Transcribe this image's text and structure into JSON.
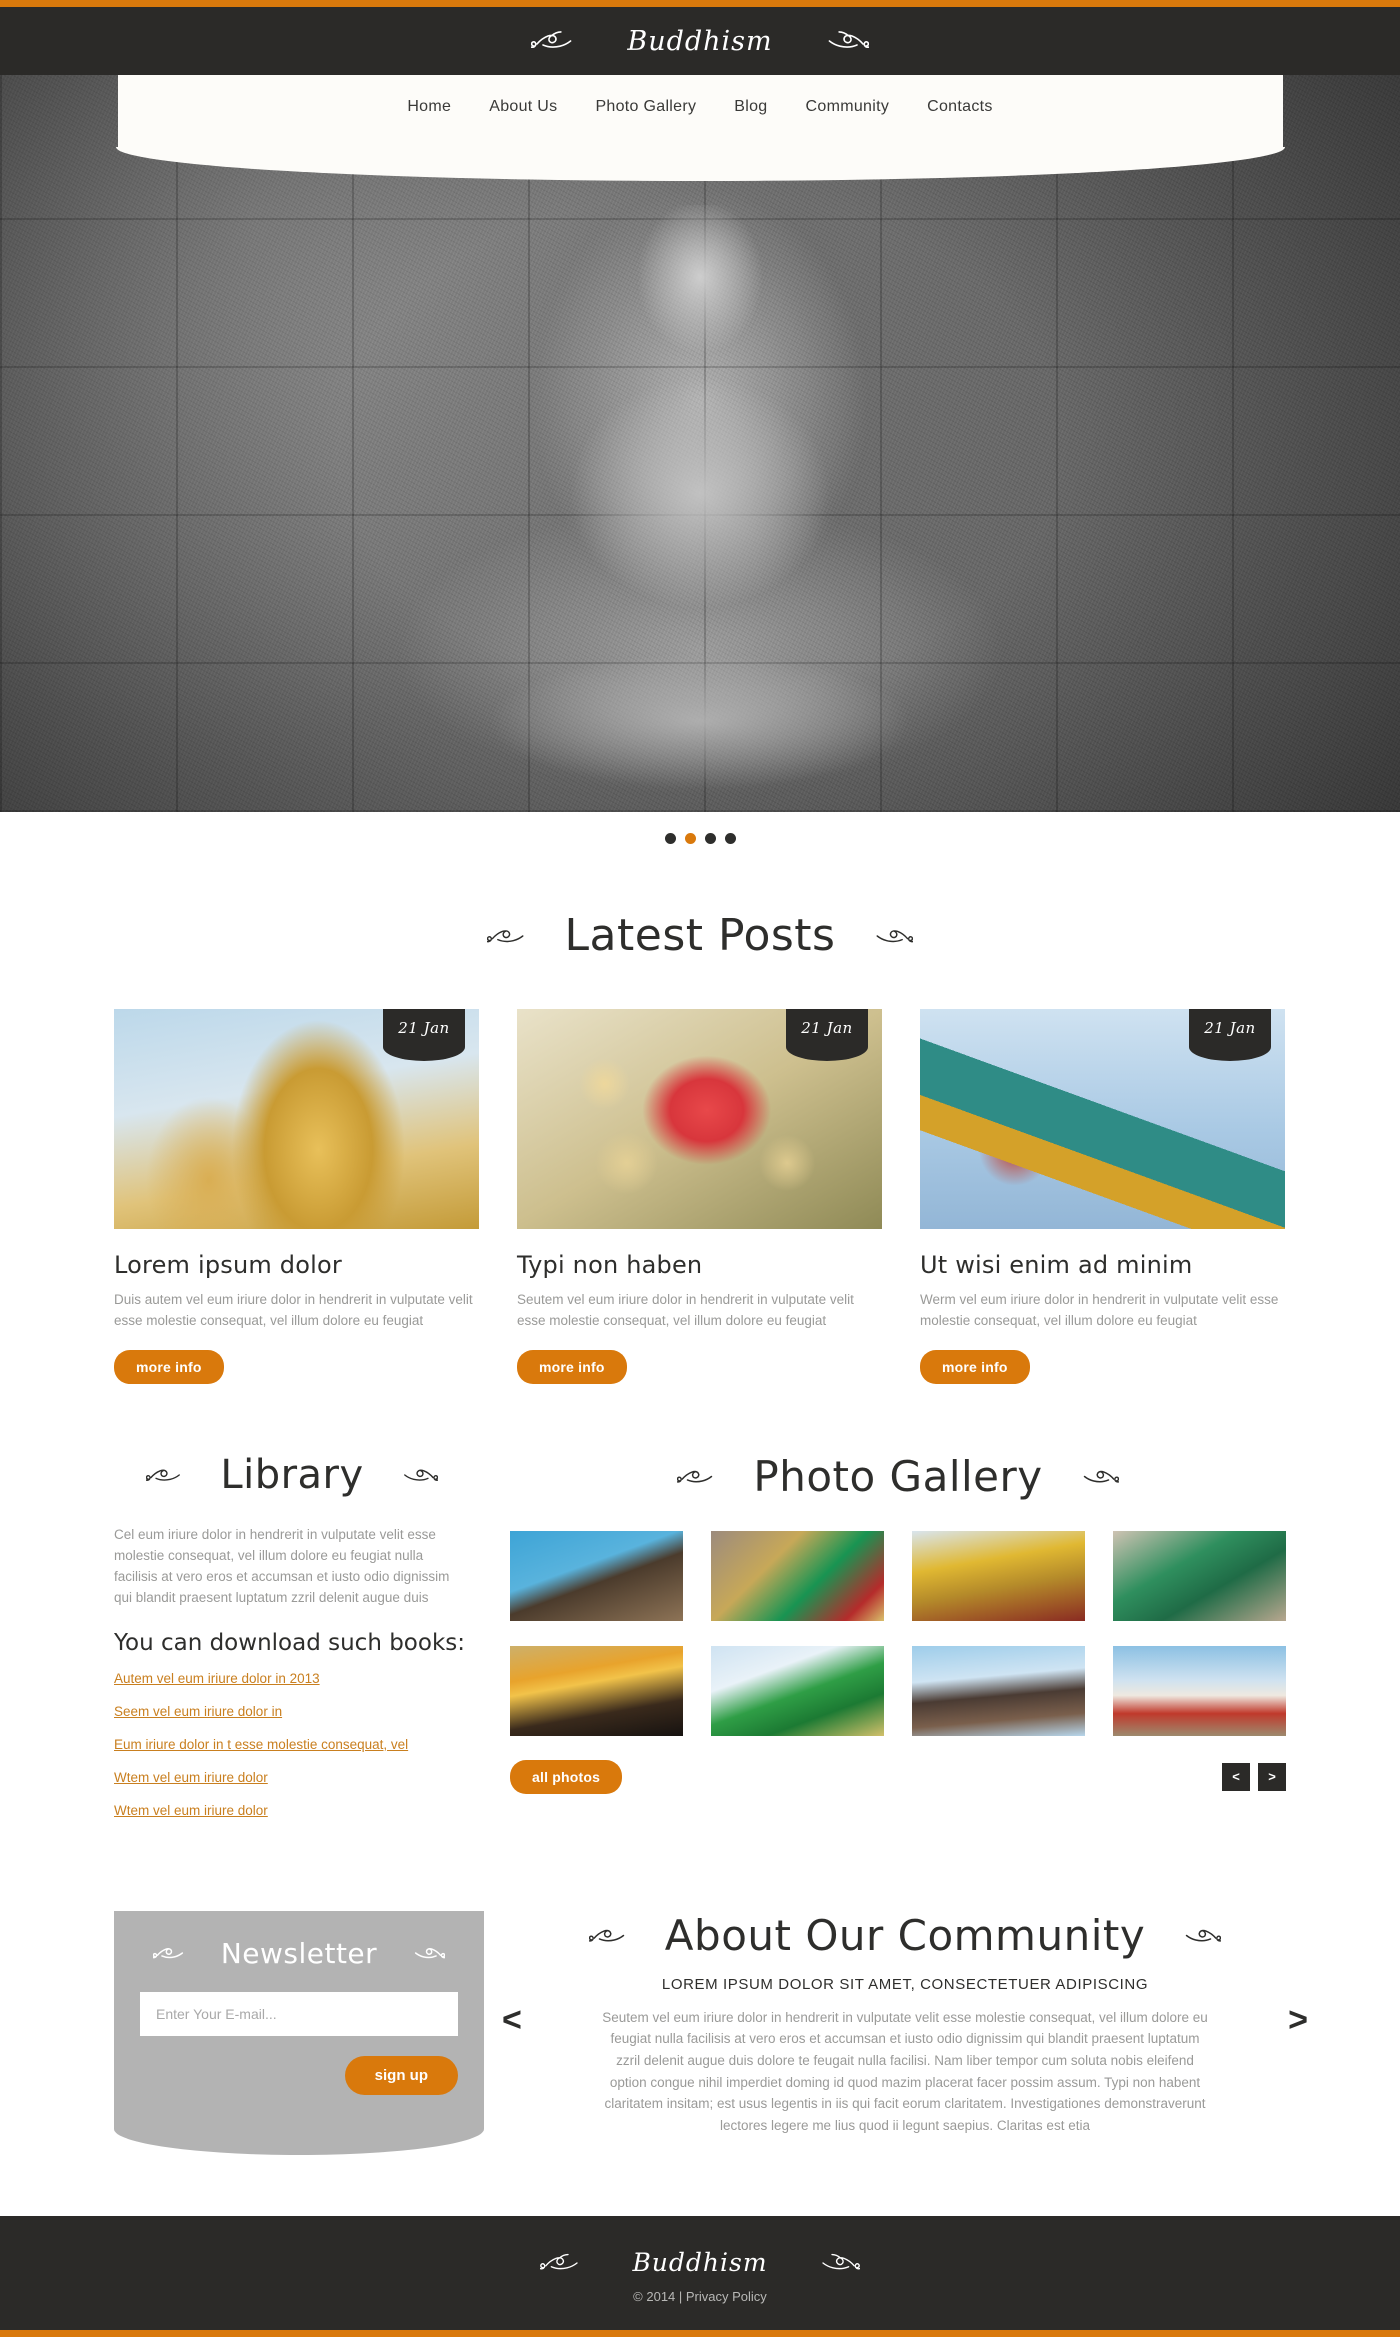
{
  "brand": {
    "name": "Buddhism",
    "left_flourish_icon": "flourish-left-icon",
    "right_flourish_icon": "flourish-right-icon"
  },
  "colors": {
    "accent": "#d9790c",
    "dark": "#2b2a28",
    "muted_text": "#9a9a98",
    "link": "#c97f1f",
    "newsletter_bg": "#b3b3b3"
  },
  "nav": {
    "items": [
      {
        "label": "Home"
      },
      {
        "label": "About Us"
      },
      {
        "label": "Photo Gallery"
      },
      {
        "label": "Blog"
      },
      {
        "label": "Community"
      },
      {
        "label": "Contacts"
      }
    ]
  },
  "hero": {
    "image_alt": "stone-relief-buddha-carving",
    "slider_dots": [
      {
        "active": false
      },
      {
        "active": true
      },
      {
        "active": false
      },
      {
        "active": false
      }
    ]
  },
  "latest_posts": {
    "title": "Latest Posts",
    "posts": [
      {
        "date": "21 Jan",
        "title": "Lorem ipsum dolor",
        "excerpt": "Duis autem vel eum iriure dolor in hendrerit in vulputate velit esse molestie consequat, vel illum dolore eu feugiat",
        "button": "more info",
        "image_alt": "golden-buddha-statue"
      },
      {
        "date": "21 Jan",
        "title": "Typi non haben",
        "excerpt": "Seutem vel eum iriure dolor in hendrerit in vulputate velit esse molestie consequat, vel illum dolore eu feugiat",
        "button": "more info",
        "image_alt": "cannonball-tree-flower"
      },
      {
        "date": "21 Jan",
        "title": "Ut wisi enim ad minim",
        "excerpt": "Werm vel eum iriure dolor in hendrerit in vulputate velit esse molestie consequat, vel illum dolore eu feugiat",
        "button": "more info",
        "image_alt": "temple-roof-eave"
      }
    ]
  },
  "library": {
    "title": "Library",
    "intro": "Cel eum iriure dolor in hendrerit in vulputate velit esse molestie consequat, vel illum dolore eu feugiat nulla facilisis at vero eros et accumsan et iusto odio dignissim qui blandit praesent luptatum zzril delenit augue duis",
    "subtitle": "You can download such books:",
    "books": [
      {
        "label": "Autem vel eum iriure dolor in 2013"
      },
      {
        "label": "Seem vel eum iriure dolor in"
      },
      {
        "label": "Eum iriure dolor in t esse molestie consequat, vel"
      },
      {
        "label": "Wtem vel eum iriure dolor"
      },
      {
        "label": "Wtem vel eum iriure dolor"
      }
    ]
  },
  "gallery": {
    "title": "Photo Gallery",
    "all_photos_button": "all photos",
    "prev_arrow": "<",
    "next_arrow": ">",
    "thumbs": [
      {
        "alt": "pagoda-roof"
      },
      {
        "alt": "thai-cave-figures"
      },
      {
        "alt": "golden-buddha-row"
      },
      {
        "alt": "green-ceramic-lion"
      },
      {
        "alt": "oil-lamp-flame"
      },
      {
        "alt": "green-giant-guardian"
      },
      {
        "alt": "naga-serpent-heads"
      },
      {
        "alt": "white-temple-building"
      }
    ]
  },
  "newsletter": {
    "title": "Newsletter",
    "email_placeholder": "Enter Your E-mail...",
    "email_value": "",
    "signup_button": "sign up"
  },
  "community": {
    "title": "About Our Community",
    "subtitle": "LOREM IPSUM DOLOR SIT AMET, CONSECTETUER ADIPISCING",
    "body": "Seutem vel eum iriure dolor in hendrerit in vulputate velit esse molestie consequat, vel illum dolore eu feugiat nulla facilisis at vero eros et accumsan et iusto odio dignissim qui blandit praesent luptatum zzril delenit augue duis dolore te feugait nulla facilisi. Nam liber tempor cum soluta nobis eleifend option congue nihil imperdiet doming id quod mazim placerat facer possim assum. Typi non habent claritatem insitam; est usus legentis in iis qui facit eorum claritatem. Investigationes demonstraverunt lectores legere me lius quod ii legunt saepius. Claritas est etia",
    "prev_arrow": "<",
    "next_arrow": ">"
  },
  "footer": {
    "brand": "Buddhism",
    "copyright": "© 2014 | ",
    "privacy_label": "Privacy Policy"
  }
}
